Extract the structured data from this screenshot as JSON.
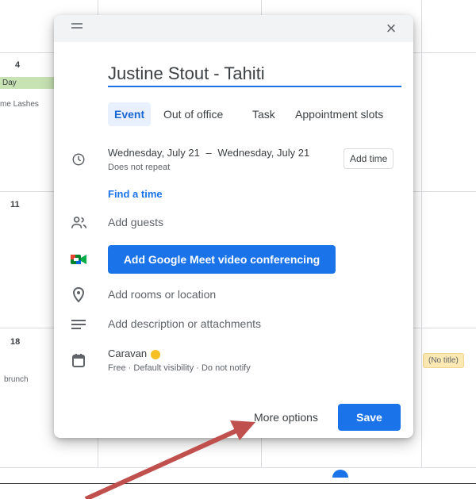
{
  "calendar": {
    "days": [
      {
        "number": "4",
        "allday": "Day",
        "event": "me Lashes"
      },
      {
        "number": "11"
      },
      {
        "number": "18",
        "event": "brunch"
      }
    ],
    "right_chip": "(No title)"
  },
  "dialog": {
    "title_value": "Justine Stout - Tahiti",
    "tabs": [
      {
        "label": "Event",
        "active": true
      },
      {
        "label": "Out of office"
      },
      {
        "label": "Task"
      },
      {
        "label": "Appointment slots"
      }
    ],
    "date": {
      "start": "Wednesday, July 21",
      "separator": "–",
      "end": "Wednesday, July 21",
      "repeat": "Does not repeat",
      "add_time_label": "Add time"
    },
    "find_time_label": "Find a time",
    "add_guests_label": "Add guests",
    "meet_button_label": "Add Google Meet video conferencing",
    "location_label": "Add rooms or location",
    "description_label": "Add description or attachments",
    "calendar": {
      "name": "Caravan",
      "dot_color": "#f6bf26",
      "details": "Free · Default visibility · Do not notify"
    },
    "more_options_label": "More options",
    "save_label": "Save"
  },
  "colors": {
    "accent": "#1a73e8",
    "arrow": "#c0504d"
  },
  "icons": [
    "drag-handle-icon",
    "close-icon",
    "clock-icon",
    "people-icon",
    "google-meet-icon",
    "location-pin-icon",
    "description-lines-icon",
    "calendar-icon"
  ]
}
